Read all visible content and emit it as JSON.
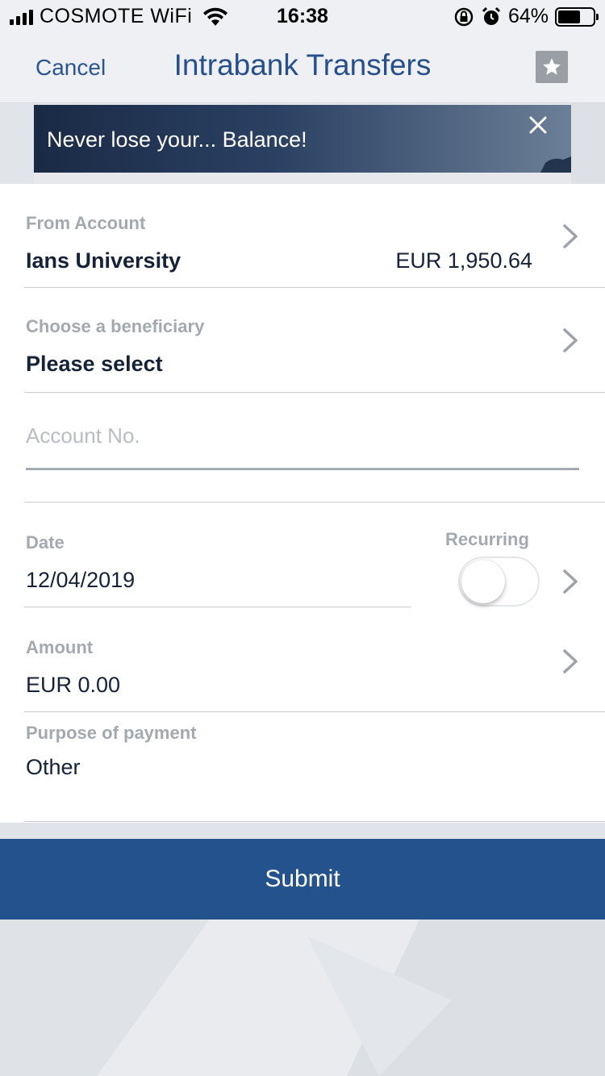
{
  "status_bar": {
    "carrier": "COSMOTE WiFi",
    "time": "16:38",
    "battery": "64%",
    "battery_level": 0.64,
    "icons": [
      "signal-icon",
      "wifi-icon",
      "rotation-lock-icon",
      "alarm-icon",
      "battery-icon"
    ]
  },
  "nav": {
    "cancel_label": "Cancel",
    "title": "Intrabank Transfers",
    "favorite_icon": "star-icon"
  },
  "banner": {
    "text": "Never lose your... Balance!",
    "close_icon": "close-icon"
  },
  "form": {
    "from_account": {
      "label": "From Account",
      "name": "Ians University",
      "balance": "EUR 1,950.64"
    },
    "beneficiary": {
      "label": "Choose a beneficiary",
      "value": "Please select"
    },
    "account_no": {
      "placeholder": "Account No.",
      "value": ""
    },
    "date": {
      "label": "Date",
      "value": "12/04/2019"
    },
    "recurring": {
      "label": "Recurring",
      "enabled": false
    },
    "amount": {
      "label": "Amount",
      "value": "EUR 0.00"
    },
    "purpose": {
      "label": "Purpose of payment",
      "value": "Other"
    }
  },
  "submit_label": "Submit",
  "colors": {
    "accent": "#24528c",
    "title": "#264f8c",
    "label": "#a4a9b0",
    "text": "#152238",
    "background": "#e6e8ec"
  }
}
